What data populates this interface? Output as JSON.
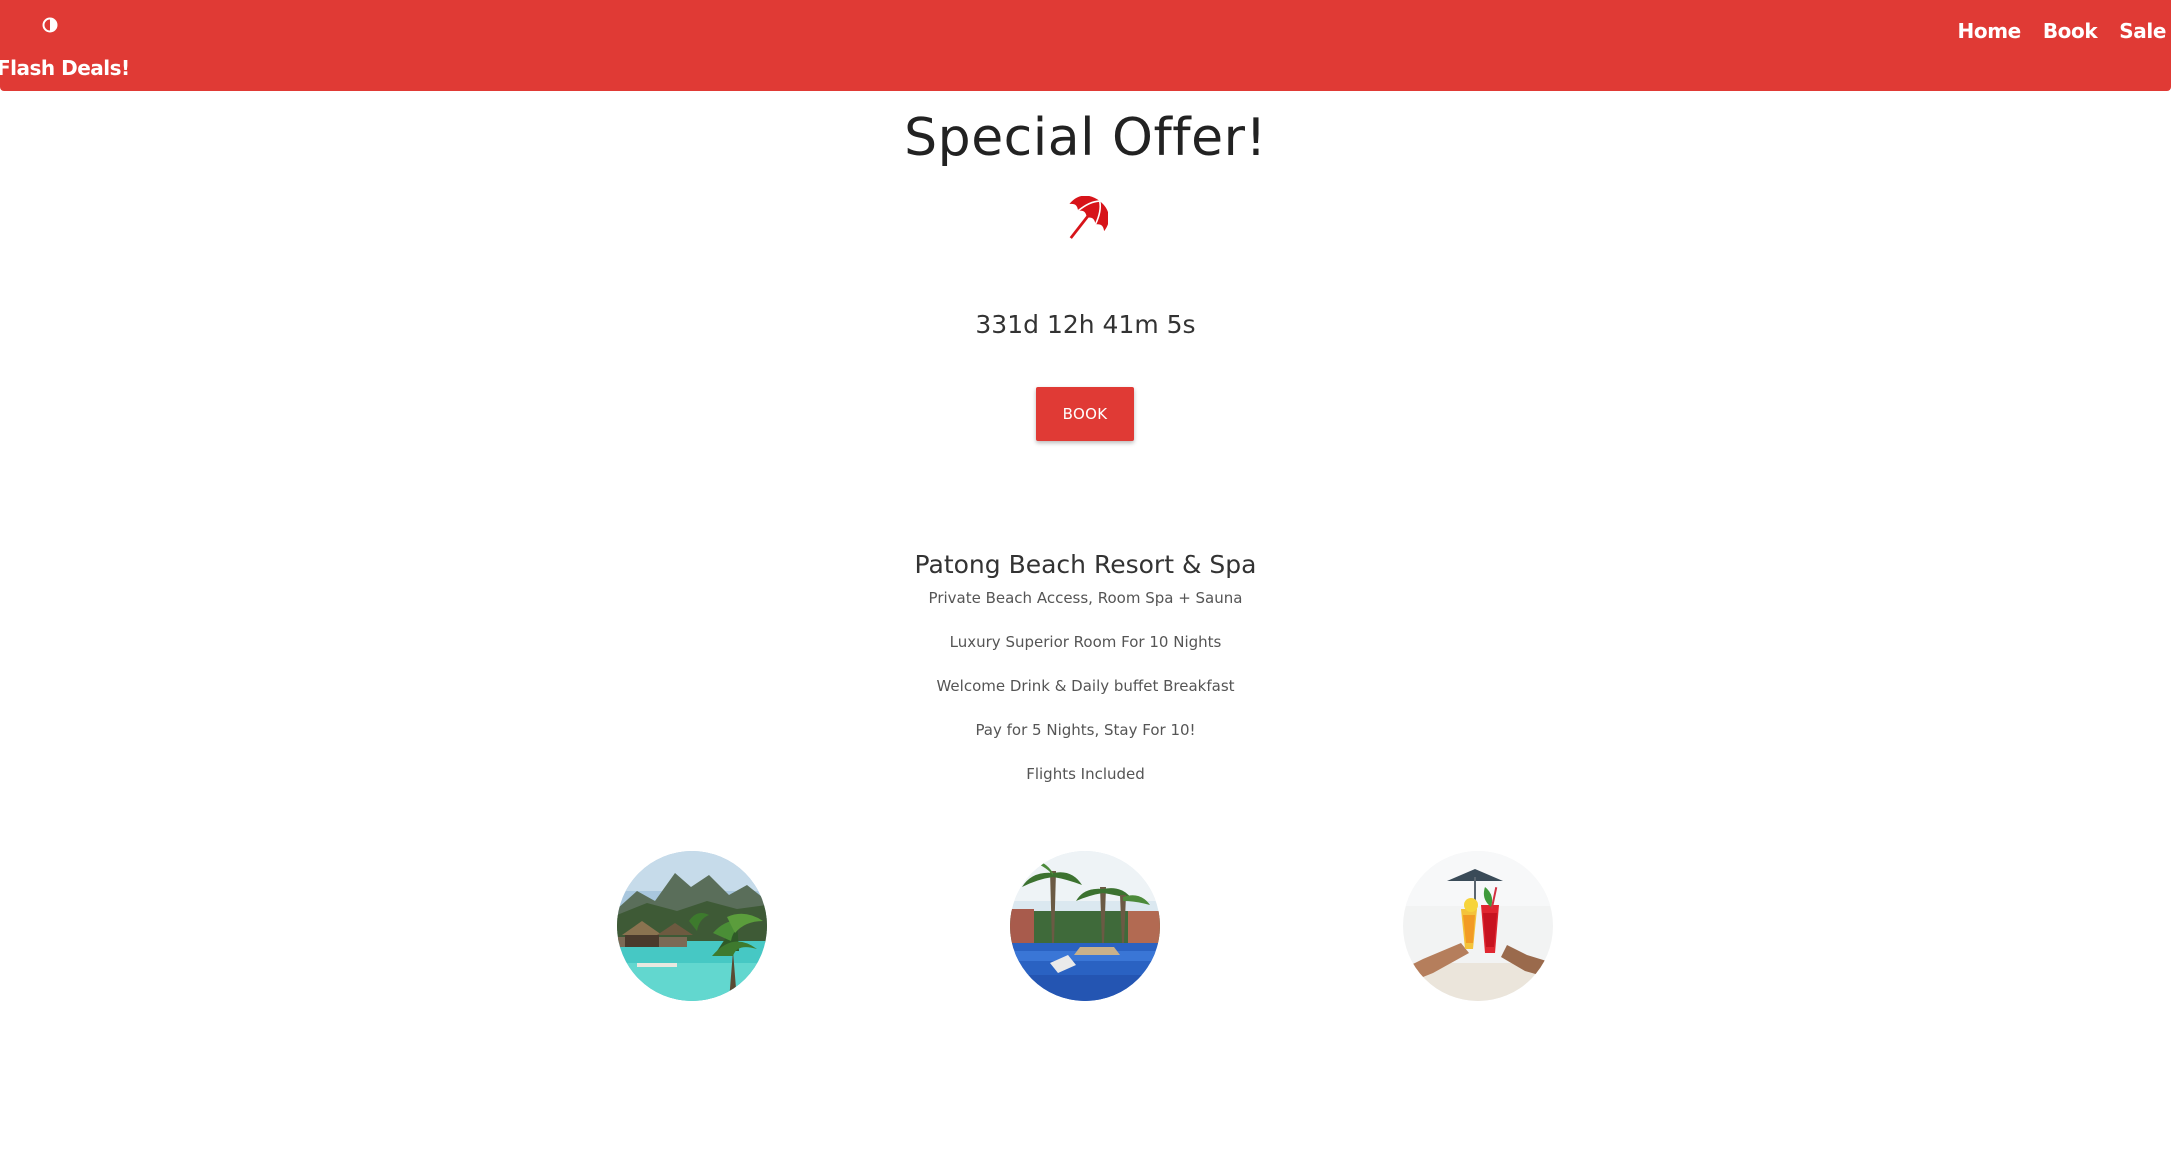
{
  "navbar": {
    "brand_icon": "half-circle-icon",
    "brand": "Flash Deals!",
    "links": [
      "Home",
      "Book",
      "Sale"
    ],
    "color": "#e03a35"
  },
  "hero": {
    "title": "Special Offer!",
    "icon": "beach-umbrella-icon",
    "countdown": "331d 12h 41m 5s",
    "book_label": "BOOK"
  },
  "resort": {
    "name": "Patong Beach Resort & Spa",
    "features": [
      "Private Beach Access, Room Spa + Sauna",
      "Luxury Superior Room For 10 Nights",
      "Welcome Drink & Daily buffet Breakfast",
      "Pay for 5 Nights, Stay For 10!",
      "Flights Included"
    ]
  },
  "gallery": [
    {
      "name": "resort-pool-image"
    },
    {
      "name": "palm-lagoon-image"
    },
    {
      "name": "cocktails-image"
    }
  ]
}
